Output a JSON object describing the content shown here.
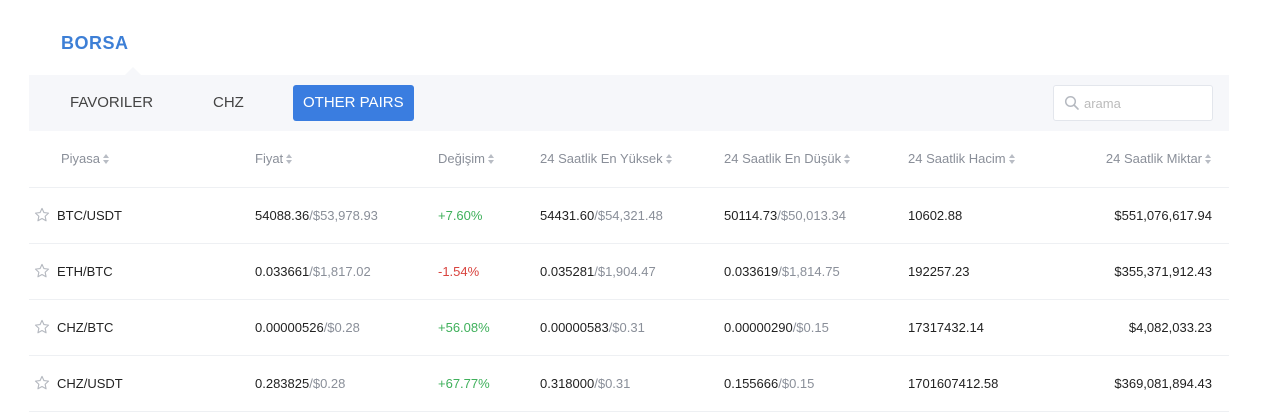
{
  "header": {
    "title": "BORSA"
  },
  "tabs": [
    {
      "label": "FAVORILER",
      "active": false
    },
    {
      "label": "CHZ",
      "active": false
    },
    {
      "label": "OTHER PAIRS",
      "active": true
    }
  ],
  "search": {
    "placeholder": "arama",
    "icon": "search-icon"
  },
  "table": {
    "columns": [
      "Piyasa",
      "Fiyat",
      "Değişim",
      "24 Saatlik En Yüksek",
      "24 Saatlik En Düşük",
      "24 Saatlik Hacim",
      "24 Saatlik Miktar"
    ],
    "rows": [
      {
        "pair": "BTC/USDT",
        "price": "54088.36",
        "price_usd": "/$53,978.93",
        "change": "+7.60%",
        "change_dir": "up",
        "high": "54431.60",
        "high_usd": "/$54,321.48",
        "low": "50114.73",
        "low_usd": "/$50,013.34",
        "volume": "10602.88",
        "amount": "$551,076,617.94"
      },
      {
        "pair": "ETH/BTC",
        "price": "0.033661",
        "price_usd": "/$1,817.02",
        "change": "-1.54%",
        "change_dir": "down",
        "high": "0.035281",
        "high_usd": "/$1,904.47",
        "low": "0.033619",
        "low_usd": "/$1,814.75",
        "volume": "192257.23",
        "amount": "$355,371,912.43"
      },
      {
        "pair": "CHZ/BTC",
        "price": "0.00000526",
        "price_usd": "/$0.28",
        "change": "+56.08%",
        "change_dir": "up",
        "high": "0.00000583",
        "high_usd": "/$0.31",
        "low": "0.00000290",
        "low_usd": "/$0.15",
        "volume": "17317432.14",
        "amount": "$4,082,033.23"
      },
      {
        "pair": "CHZ/USDT",
        "price": "0.283825",
        "price_usd": "/$0.28",
        "change": "+67.77%",
        "change_dir": "up",
        "high": "0.318000",
        "high_usd": "/$0.31",
        "low": "0.155666",
        "low_usd": "/$0.15",
        "volume": "1701607412.58",
        "amount": "$369,081,894.43"
      }
    ]
  },
  "colors": {
    "accent": "#3a7de0",
    "title": "#3d7fd6",
    "positive": "#3fb05b",
    "negative": "#d9443f",
    "muted": "#8a8f99"
  }
}
